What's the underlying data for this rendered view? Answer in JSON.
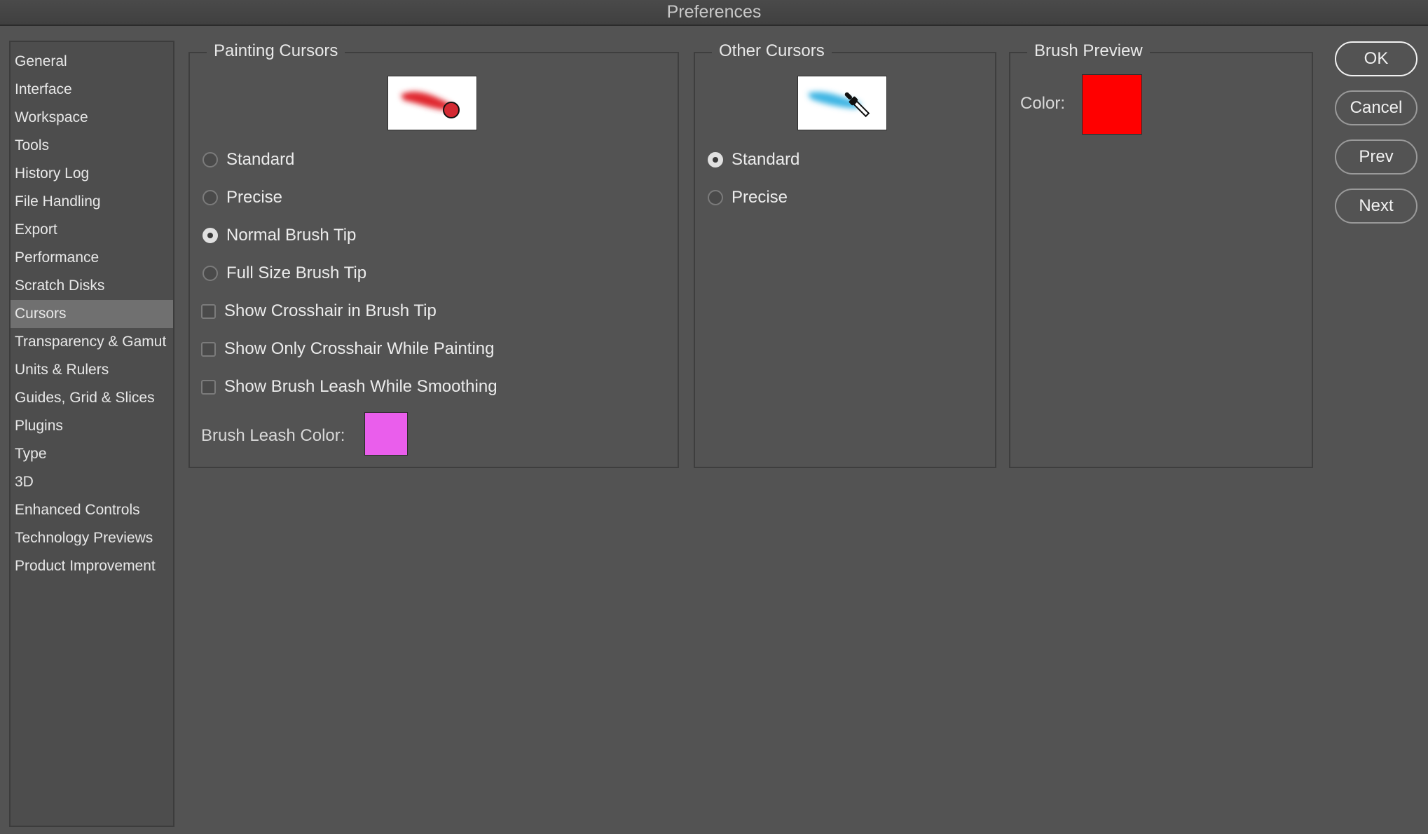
{
  "window": {
    "title": "Preferences"
  },
  "sidebar": {
    "items": [
      {
        "label": "General"
      },
      {
        "label": "Interface"
      },
      {
        "label": "Workspace"
      },
      {
        "label": "Tools"
      },
      {
        "label": "History Log"
      },
      {
        "label": "File Handling"
      },
      {
        "label": "Export"
      },
      {
        "label": "Performance"
      },
      {
        "label": "Scratch Disks"
      },
      {
        "label": "Cursors"
      },
      {
        "label": "Transparency & Gamut"
      },
      {
        "label": "Units & Rulers"
      },
      {
        "label": "Guides, Grid & Slices"
      },
      {
        "label": "Plugins"
      },
      {
        "label": "Type"
      },
      {
        "label": "3D"
      },
      {
        "label": "Enhanced Controls"
      },
      {
        "label": "Technology Previews"
      },
      {
        "label": "Product Improvement"
      }
    ],
    "selected": "Cursors"
  },
  "painting_cursors": {
    "title": "Painting Cursors",
    "preview_icon": "brush-circle-cursor-icon",
    "options": [
      {
        "label": "Standard",
        "selected": false
      },
      {
        "label": "Precise",
        "selected": false
      },
      {
        "label": "Normal Brush Tip",
        "selected": true
      },
      {
        "label": "Full Size Brush Tip",
        "selected": false
      }
    ],
    "checkboxes": [
      {
        "label": "Show Crosshair in Brush Tip",
        "checked": false
      },
      {
        "label": "Show Only Crosshair While Painting",
        "checked": false
      },
      {
        "label": "Show Brush Leash While Smoothing",
        "checked": false
      }
    ],
    "leash_color_label": "Brush Leash Color:",
    "leash_color": "#ea5eec"
  },
  "other_cursors": {
    "title": "Other Cursors",
    "preview_icon": "eyedropper-cursor-icon",
    "options": [
      {
        "label": "Standard",
        "selected": true
      },
      {
        "label": "Precise",
        "selected": false
      }
    ]
  },
  "brush_preview": {
    "title": "Brush Preview",
    "color_label": "Color:",
    "color": "#ff0000"
  },
  "buttons": {
    "ok": "OK",
    "cancel": "Cancel",
    "prev": "Prev",
    "next": "Next"
  }
}
